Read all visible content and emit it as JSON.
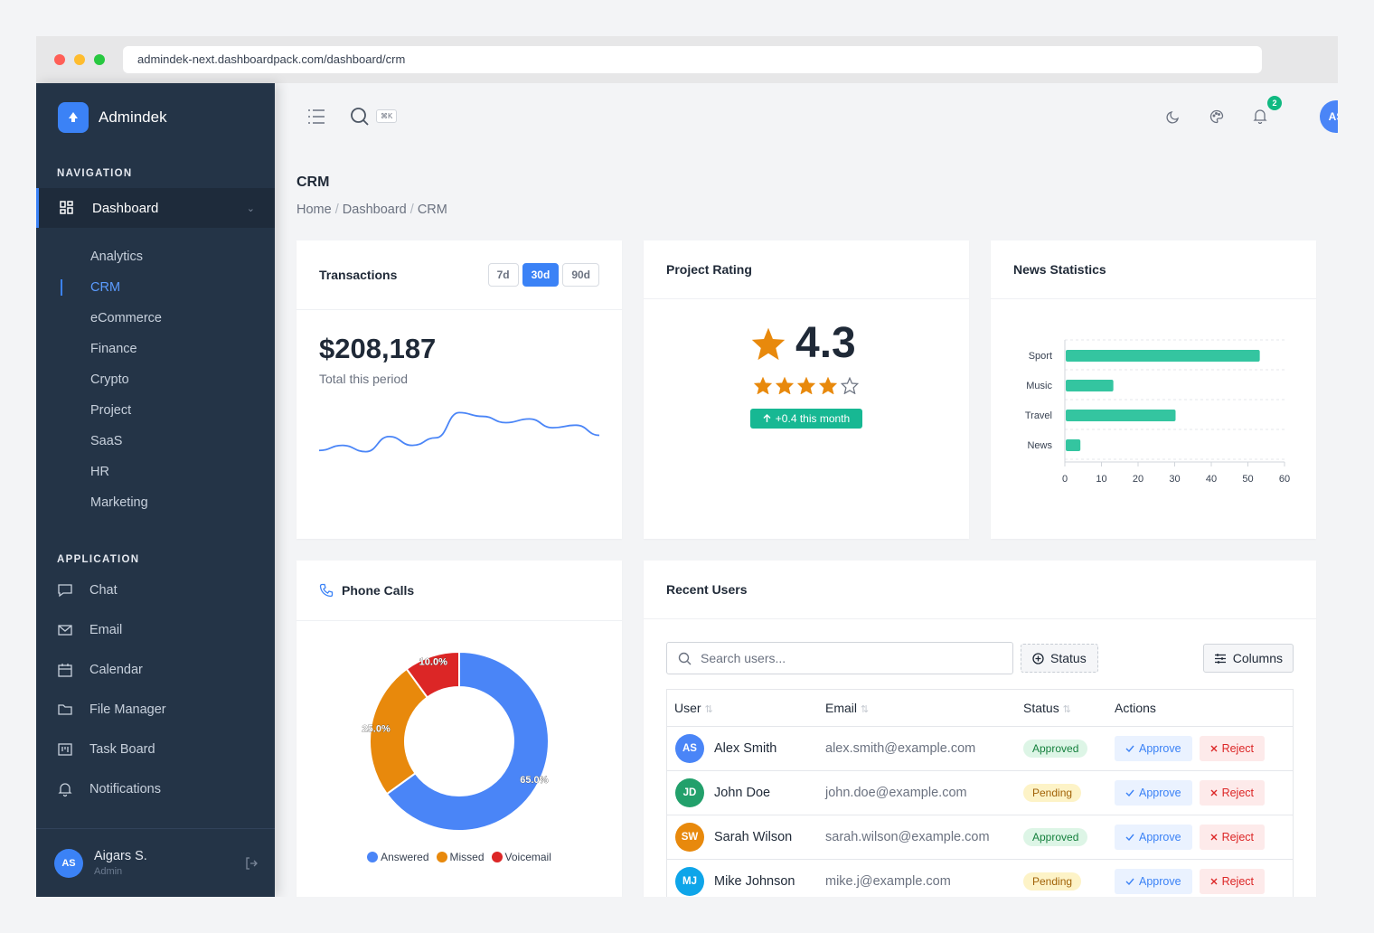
{
  "browser": {
    "url": "admindek-next.dashboardpack.com/dashboard/crm"
  },
  "brand": {
    "name": "Admindek"
  },
  "sidebar": {
    "nav_title": "NAVIGATION",
    "dashboard_label": "Dashboard",
    "sub_items": [
      "Analytics",
      "CRM",
      "eCommerce",
      "Finance",
      "Crypto",
      "Project",
      "SaaS",
      "HR",
      "Marketing"
    ],
    "active_sub": "CRM",
    "app_title": "APPLICATION",
    "app_items": [
      {
        "label": "Chat",
        "icon": "chat-icon"
      },
      {
        "label": "Email",
        "icon": "mail-icon"
      },
      {
        "label": "Calendar",
        "icon": "calendar-icon"
      },
      {
        "label": "File Manager",
        "icon": "folder-icon"
      },
      {
        "label": "Task Board",
        "icon": "kanban-icon"
      },
      {
        "label": "Notifications",
        "icon": "bell-icon"
      }
    ],
    "user": {
      "initials": "AS",
      "name": "Aigars S.",
      "role": "Admin"
    }
  },
  "topbar": {
    "shortcut": "⌘K",
    "notif_count": "2",
    "avatar_initials": "AS"
  },
  "page": {
    "title": "CRM",
    "breadcrumb": [
      "Home",
      "Dashboard",
      "CRM"
    ]
  },
  "transactions": {
    "title": "Transactions",
    "ranges": [
      "7d",
      "30d",
      "90d"
    ],
    "active_range": "30d",
    "amount": "$208,187",
    "caption": "Total this period",
    "sparkline": [
      42,
      46,
      41,
      53,
      46,
      52,
      72,
      69,
      64,
      67,
      60,
      62,
      54
    ]
  },
  "rating": {
    "title": "Project Rating",
    "value": "4.3",
    "stars_filled": 4,
    "stars_total": 5,
    "delta": "+0.4 this month"
  },
  "news": {
    "title": "News Statistics",
    "chart_data": {
      "type": "bar",
      "orientation": "horizontal",
      "categories": [
        "Sport",
        "Music",
        "Travel",
        "News"
      ],
      "values": [
        53,
        13,
        30,
        4
      ],
      "xlim": [
        0,
        60
      ],
      "xticks": [
        "0",
        "10",
        "20",
        "30",
        "40",
        "50",
        "60"
      ],
      "color": "#34c5a0"
    }
  },
  "calls": {
    "title": "Phone Calls",
    "chart_data": {
      "type": "pie",
      "donut": true,
      "categories": [
        "Answered",
        "Missed",
        "Voicemail"
      ],
      "values": [
        65.0,
        25.0,
        10.0
      ],
      "labels": [
        "65.0%",
        "25.0%",
        "10.0%"
      ],
      "colors": [
        "#4a85f7",
        "#e8890c",
        "#dc2626"
      ],
      "legend": "bottom"
    }
  },
  "users": {
    "title": "Recent Users",
    "search_placeholder": "Search users...",
    "status_filter": "Status",
    "columns_btn": "Columns",
    "headers": [
      "User",
      "Email",
      "Status",
      "Actions"
    ],
    "approve": "Approve",
    "reject": "Reject",
    "rows": [
      {
        "initials": "AS",
        "name": "Alex Smith",
        "email": "alex.smith@example.com",
        "status": "Approved",
        "color": "#4a85f7"
      },
      {
        "initials": "JD",
        "name": "John Doe",
        "email": "john.doe@example.com",
        "status": "Pending",
        "color": "#22a06b"
      },
      {
        "initials": "SW",
        "name": "Sarah Wilson",
        "email": "sarah.wilson@example.com",
        "status": "Approved",
        "color": "#e8890c"
      },
      {
        "initials": "MJ",
        "name": "Mike Johnson",
        "email": "mike.j@example.com",
        "status": "Pending",
        "color": "#0ea5e9"
      }
    ]
  }
}
